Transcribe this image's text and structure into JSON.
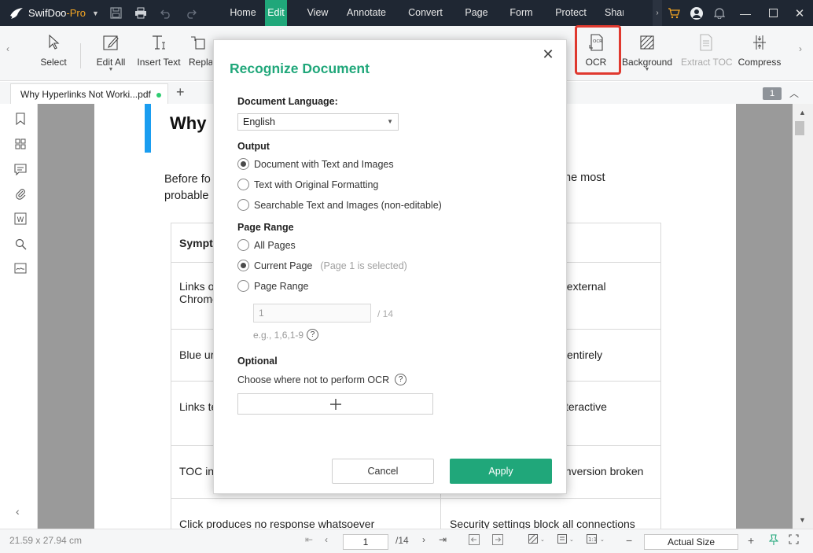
{
  "app": {
    "name": "SwifDoo",
    "name_suffix": "-Pro",
    "accent_color": "#20a77a",
    "titlebar_color": "#1f2733"
  },
  "menu": {
    "items": [
      {
        "label": "Home",
        "active": false
      },
      {
        "label": "Edit",
        "active": true
      },
      {
        "label": "View",
        "active": false
      },
      {
        "label": "Annotate",
        "active": false
      },
      {
        "label": "Convert",
        "active": false
      },
      {
        "label": "Page",
        "active": false
      },
      {
        "label": "Form",
        "active": false
      },
      {
        "label": "Protect",
        "active": false
      },
      {
        "label": "Share",
        "active": false
      }
    ]
  },
  "ribbon": {
    "tools": [
      {
        "label": "Select",
        "icon": "cursor-icon"
      },
      {
        "label": "Edit All",
        "icon": "edit-all-icon"
      },
      {
        "label": "Insert Text",
        "icon": "insert-text-icon"
      },
      {
        "label": "Replace",
        "icon": "replace-icon"
      },
      {
        "label": "OCR",
        "icon": "ocr-icon"
      },
      {
        "label": "Background",
        "icon": "background-icon"
      },
      {
        "label": "Extract TOC",
        "icon": "extract-toc-icon"
      },
      {
        "label": "Compress",
        "icon": "compress-icon"
      }
    ],
    "highlight_color": "#e0392f"
  },
  "tabs": {
    "doc_tab": "Why Hyperlinks Not Worki...pdf",
    "page_badge": "1"
  },
  "document": {
    "heading": "Why",
    "intro_line1": "Before fo",
    "intro_line2": "probable",
    "intro_right": "he most",
    "rows": [
      {
        "c1": "Sympt",
        "c2": ""
      },
      {
        "c1": "Links o\nChrome",
        "c2": "ts external"
      },
      {
        "c1": "Blue ur",
        "c2": "entirely"
      },
      {
        "c1": "Links te",
        "c2": "teractive"
      },
      {
        "c1": "TOC in",
        "c2": "onversion broken"
      },
      {
        "c1": "Click produces no response whatsoever",
        "c2": "Security settings block all connections"
      }
    ]
  },
  "statusbar": {
    "page_size": "21.59 x 27.94 cm",
    "current_page": "1",
    "total_pages": "/14",
    "zoom": "Actual Size"
  },
  "dialog": {
    "title": "Recognize Document",
    "language_label": "Document Language:",
    "language_value": "English",
    "output_label": "Output",
    "output_options": [
      {
        "label": "Document with Text and Images",
        "selected": true
      },
      {
        "label": "Text with Original Formatting",
        "selected": false
      },
      {
        "label": "Searchable Text and Images (non-editable)",
        "selected": false
      }
    ],
    "page_range_label": "Page Range",
    "all_pages": "All Pages",
    "current_page": "Current Page",
    "current_page_hint": "(Page 1 is selected)",
    "page_range": "Page Range",
    "range_value": "1",
    "range_of": "/ 14",
    "range_example": "e.g., 1,6,1-9",
    "optional_label": "Optional",
    "optional_desc": "Choose where not to perform OCR",
    "cancel": "Cancel",
    "apply": "Apply"
  }
}
